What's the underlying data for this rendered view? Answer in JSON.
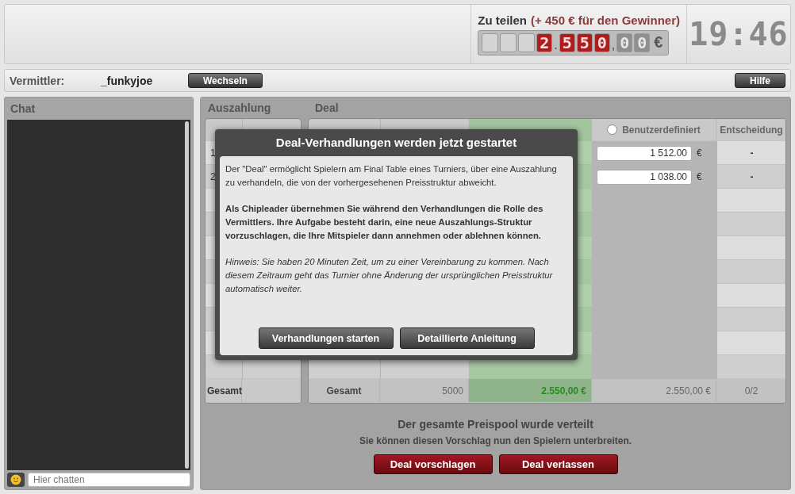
{
  "pot": {
    "label": "Zu teilen",
    "bonus": "(+ 450 € für den Gewinner)",
    "slots": [
      {
        "kind": "slot"
      },
      {
        "kind": "slot"
      },
      {
        "kind": "slot"
      },
      {
        "kind": "digit",
        "char": "2",
        "lit": true
      },
      {
        "kind": "sep",
        "char": "."
      },
      {
        "kind": "digit",
        "char": "5",
        "lit": true
      },
      {
        "kind": "digit",
        "char": "5",
        "lit": true
      },
      {
        "kind": "digit",
        "char": "0",
        "lit": true
      },
      {
        "kind": "sep",
        "char": ","
      },
      {
        "kind": "digit",
        "char": "0",
        "lit": false
      },
      {
        "kind": "digit",
        "char": "0",
        "lit": false
      },
      {
        "kind": "unit",
        "char": "€"
      }
    ]
  },
  "clock": "19:46",
  "mediator": {
    "label": "Vermittler:",
    "name": "_funkyjoe",
    "change_button": "Wechseln",
    "help_button": "Hilfe"
  },
  "chat": {
    "title": "Chat",
    "placeholder": "Hier chatten"
  },
  "payout": {
    "title": "Auszahlung",
    "rows": [
      {
        "rank": "1"
      },
      {
        "rank": "2"
      }
    ],
    "total_label": "Gesamt"
  },
  "deal": {
    "title": "Deal",
    "columns": [
      {
        "kind": "radio",
        "label": "Benutzerdefiniert",
        "selected": false
      },
      {
        "kind": "text",
        "label": "Entscheidung"
      }
    ],
    "rows": [
      {
        "custom": "1 512.00",
        "currency": "€",
        "decision": "-"
      },
      {
        "custom": "1 038.00",
        "currency": "€",
        "decision": "-"
      }
    ],
    "totals": [
      "Gesamt",
      "5000",
      "2.550,00 €",
      "2.550,00 €",
      "0/2"
    ]
  },
  "status": {
    "headline": "Der gesamte Preispool wurde verteilt",
    "subline": "Sie können diesen Vorschlag nun den Spielern unterbreiten.",
    "buttons": [
      "Deal vorschlagen",
      "Deal verlassen"
    ]
  },
  "dialog": {
    "title": "Deal-Verhandlungen werden jetzt gestartet",
    "paragraphs": [
      {
        "kind": "normal",
        "text": "Der \"Deal\" ermöglicht Spielern am Final Table eines Turniers, über eine Auszahlung zu verhandeln, die von der vorhergesehenen Preisstruktur abweicht."
      },
      {
        "kind": "bold",
        "text": "Als Chipleader übernehmen Sie während den Verhandlungen die Rolle des Vermittlers. Ihre Aufgabe besteht darin, eine neue Auszahlungs-Struktur vorzuschlagen, die Ihre Mitspieler dann annehmen oder ablehnen können."
      },
      {
        "kind": "italic",
        "text": "Hinweis: Sie haben 20 Minuten Zeit, um zu einer Vereinbarung zu kommen. Nach diesem Zeitraum geht das Turnier ohne Änderung der ursprünglichen Preisstruktur automatisch weiter."
      }
    ],
    "buttons": [
      "Verhandlungen starten",
      "Detaillierte Anleitung"
    ]
  }
}
